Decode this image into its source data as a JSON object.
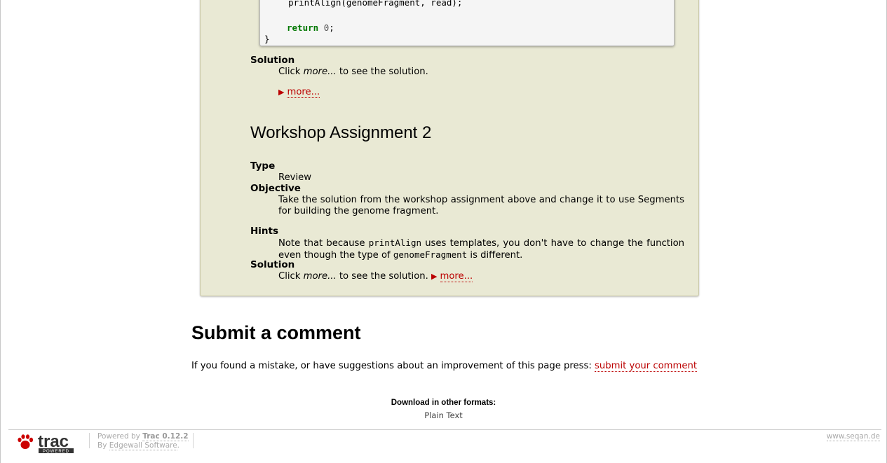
{
  "code": {
    "line1": "    printAlign(genomeFragment, read);",
    "kw_return": "return",
    "ret_value": "0",
    "semicolon": ";",
    "brace": "}"
  },
  "assignment1": {
    "solution_label": "Solution",
    "solution_text_pre": "Click ",
    "solution_text_em": "more...",
    "solution_text_post": " to see the solution.",
    "more_label": "more..."
  },
  "assignment2": {
    "heading": "Workshop Assignment 2",
    "type_label": "Type",
    "type_value": "Review",
    "objective_label": "Objective",
    "objective_value": "Take the solution from the workshop assignment above and change it to use Segments for building the genome fragment.",
    "hints_label": "Hints",
    "hints_pre": "Note that because ",
    "hints_code1": "printAlign",
    "hints_mid": " uses templates, you don't have to change the function even though the type of ",
    "hints_code2": "genomeFragment",
    "hints_post": " is different.",
    "solution_label": "Solution",
    "solution_text_pre": "Click ",
    "solution_text_em": "more...",
    "solution_text_post": " to see the solution.",
    "more_label": "more..."
  },
  "comment": {
    "heading": "Submit a comment",
    "text": "If you found a mistake, or have suggestions about an improvement of this page press: ",
    "link": "submit your comment"
  },
  "formats": {
    "title": "Download in other formats:",
    "plain_text": "Plain Text"
  },
  "footer": {
    "logo_text": "trac",
    "logo_sub": "POWERED",
    "powered_by": "Powered by ",
    "trac_version": "Trac 0.12.2",
    "by": "By ",
    "edgewall": "Edgewall Software",
    "period": ".",
    "site": "www.seqan.de"
  },
  "colors": {
    "box_bg": "#e9e9d4",
    "link": "#bb0000",
    "keyword": "#007700"
  }
}
